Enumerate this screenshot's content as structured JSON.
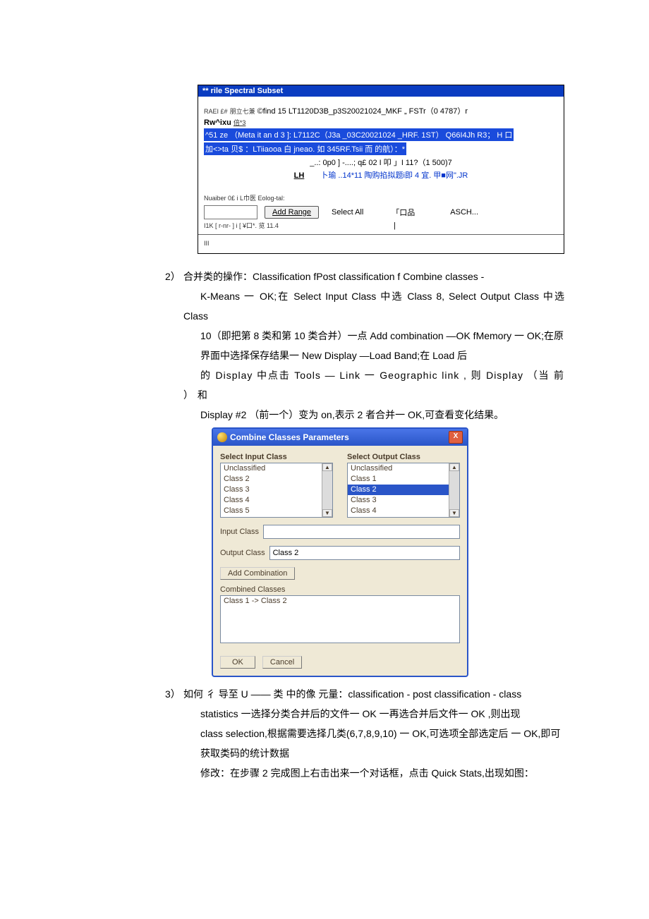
{
  "spectral": {
    "title": "** rile Spectral Subset",
    "line1_left": "RAEI £#",
    "line1_mid": "朋立七兼",
    "line1_right": "©find 15 LT1120D3B_p3S20021024_MKF „ FSTr（0 4787）r",
    "line2_left": "Rw^ixu",
    "line2_mid": "倍*3",
    "line3_sel": "^51 ze （Meta it an d 3 ]: L7112C（J3a _03C20021024 _HRF. 1ST） Q66I4Jh R3； H 口",
    "line4_sel": "加<>ta 贝$ ：LTiiaooa 白 jneao. 如 345RF.Tsii 而 的航）：*",
    "line5": "_..: 0p0 ] -....; q£ 02   I  叩 」I 11?（1 500)7",
    "line6_left": "LH",
    "line6_right": "卜瑜 ..14*11 陶购掐拟题i即 4 宜. 甲■网\".JR",
    "nuaiber": "Nuaiber 0£ i L巾医  Eolog-tal:",
    "add_range": "Add Range",
    "select_all": "Select All",
    "asch": "ASCH...",
    "i1k": "I1K [ r-nr- ] i [ ¥口*. 览 11.4",
    "bottom_marks": "III"
  },
  "para2": {
    "num": "2）",
    "l1": "合并类的操作：Classification fPost classification f Combine classes -",
    "l2": "K-Means 一 OK;在 Select Input Class 中选 Class 8, Select Output Class 中选 Class",
    "l3": "10（即把第 8 类和第 10 类合并）一点 Add combination —OK fMemory 一 OK;在原",
    "l4": "界面中选择保存结果一 New Display —Load Band;在 Load 后",
    "l5": "的  Display 中点击  Tools — Link 一  Geographic link , 则  Display （当 前 ） 和",
    "l6": "Display #2 （前一个）变为 on,表示 2 者合并一 OK,可查看变化结果。"
  },
  "combine": {
    "title": "Combine Classes Parameters",
    "sel_input_label": "Select Input Class",
    "sel_output_label": "Select Output Class",
    "input_items": [
      "Unclassified",
      "Class 2",
      "Class 3",
      "Class 4",
      "Class 5"
    ],
    "output_items": [
      "Unclassified",
      "Class 1",
      "Class 2",
      "Class 3",
      "Class 4"
    ],
    "output_selected_index": 2,
    "input_class_label": "Input Class",
    "input_class_value": "",
    "output_class_label": "Output Class",
    "output_class_value": "Class 2",
    "add_combination": "Add Combination",
    "combined_classes_label": "Combined Classes",
    "combined_value": "Class 1 -> Class 2",
    "ok": "OK",
    "cancel": "Cancel"
  },
  "para3": {
    "num": "3）",
    "l1": "如何 彳 导至 U —— 类 中的像 元量：classification - post classification - class",
    "l2": "statistics 一选择分类合并后的文件一 OK 一再选合并后文件一 OK ,则出现",
    "l3": "class selection,根据需要选择几类(6,7,8,9,10) 一 OK,可选项全部选定后 一 OK,即可",
    "l4": "获取类码的统计数据",
    "l5": "修改：在步骤 2 完成图上右击出来一个对话框，点击 Quick Stats,出现如图："
  }
}
